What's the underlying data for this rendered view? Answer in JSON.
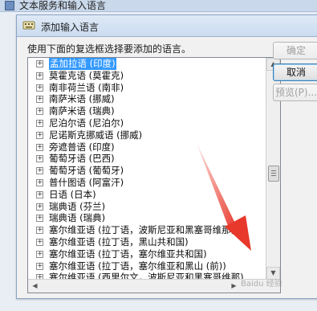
{
  "background_window": {
    "title": "文本服务和输入语言"
  },
  "dialog": {
    "title": "添加输入语言",
    "instruction": "使用下面的复选框选择要添加的语言。",
    "languages": [
      {
        "label": "孟加拉语 (印度)",
        "selected": true
      },
      {
        "label": "莫霍克语 (莫霍克)",
        "selected": false
      },
      {
        "label": "南非荷兰语 (南非)",
        "selected": false
      },
      {
        "label": "南萨米语 (挪威)",
        "selected": false
      },
      {
        "label": "南萨米语 (瑞典)",
        "selected": false
      },
      {
        "label": "尼泊尔语 (尼泊尔)",
        "selected": false
      },
      {
        "label": "尼诺斯克挪威语 (挪威)",
        "selected": false
      },
      {
        "label": "旁遮普语 (印度)",
        "selected": false
      },
      {
        "label": "葡萄牙语 (巴西)",
        "selected": false
      },
      {
        "label": "葡萄牙语 (葡萄牙)",
        "selected": false
      },
      {
        "label": "普什图语 (阿富汗)",
        "selected": false
      },
      {
        "label": "日语 (日本)",
        "selected": false
      },
      {
        "label": "瑞典语 (芬兰)",
        "selected": false
      },
      {
        "label": "瑞典语 (瑞典)",
        "selected": false
      },
      {
        "label": "塞尔维亚语 (拉丁语，波斯尼亚和黑塞哥维那)",
        "selected": false
      },
      {
        "label": "塞尔维亚语 (拉丁语，黑山共和国)",
        "selected": false
      },
      {
        "label": "塞尔维亚语 (拉丁语，塞尔维亚共和国)",
        "selected": false
      },
      {
        "label": "塞尔维亚语 (拉丁语，塞尔维亚和黑山 (前))",
        "selected": false
      },
      {
        "label": "塞尔维亚语 (西里尔文，波斯尼亚和黑塞哥维那)",
        "selected": false
      }
    ],
    "buttons": {
      "ok": "确定",
      "cancel": "取消",
      "preview": "预览(P)..."
    }
  },
  "colors": {
    "selection": "#3399ff",
    "annotation_arrow": "#e8372b"
  },
  "watermark": "Baidu 经验"
}
